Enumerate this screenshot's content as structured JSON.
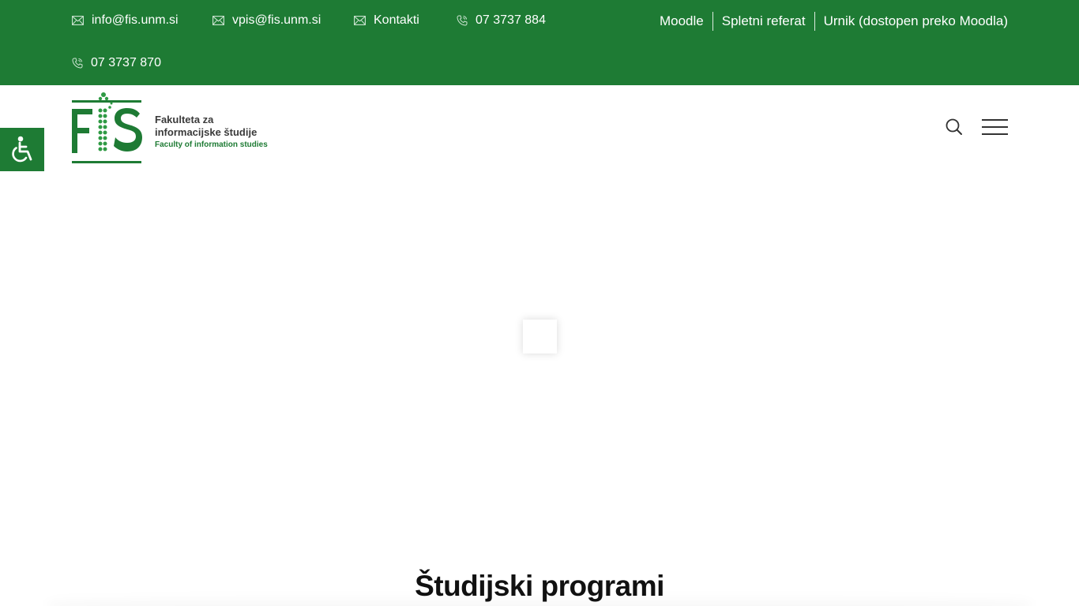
{
  "topbar": {
    "contacts": [
      {
        "icon": "mail-icon",
        "text": "info@fis.unm.si"
      },
      {
        "icon": "mail-icon",
        "text": "vpis@fis.unm.si"
      },
      {
        "icon": "mail-icon",
        "text": "Kontakti"
      },
      {
        "icon": "phone-icon",
        "text": "07 3737 884"
      },
      {
        "icon": "phone-icon",
        "text": "07 3737 870"
      }
    ],
    "links": [
      "Moodle",
      "Spletni referat",
      "Urnik (dostopen preko Moodla)"
    ]
  },
  "header": {
    "logo": {
      "mark": "FIS",
      "line1": "Fakulteta za",
      "line2": "informacijske študije",
      "line3": "Faculty of information studies"
    },
    "search_icon": "search-icon",
    "menu_icon": "hamburger-menu-icon"
  },
  "accessibility_icon": "wheelchair-icon",
  "section": {
    "title": "Študijski programi"
  },
  "colors": {
    "brand_green": "#1e7b34",
    "text_dark": "#111111"
  }
}
